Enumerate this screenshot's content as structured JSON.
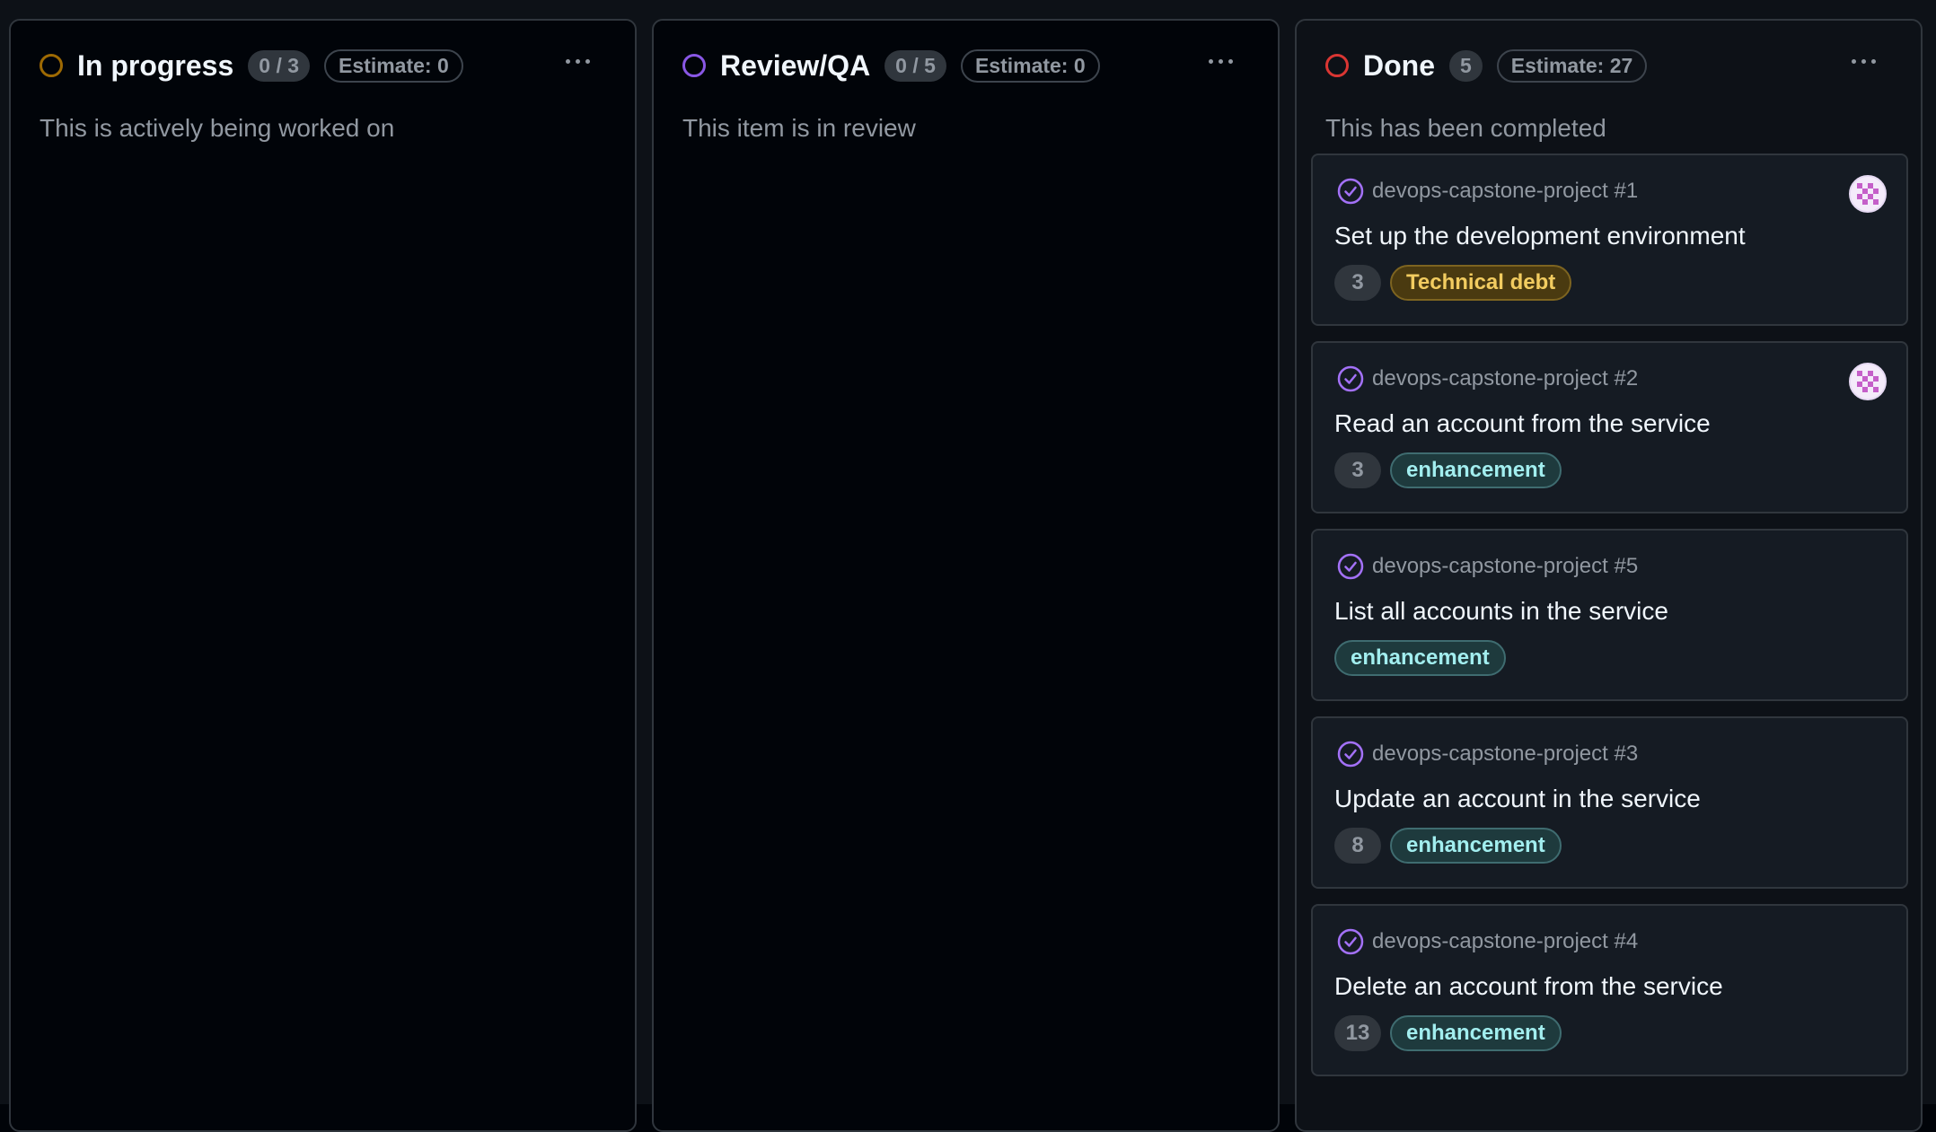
{
  "columns": [
    {
      "title": "In progress",
      "count": "0 / 3",
      "estimate": "Estimate: 0",
      "description": "This is actively being worked on",
      "ring_color": "#9e6a03",
      "cards": []
    },
    {
      "title": "Review/QA",
      "count": "0 / 5",
      "estimate": "Estimate: 0",
      "description": "This item is in review",
      "ring_color": "#8957e5",
      "cards": []
    },
    {
      "title": "Done",
      "count": "5",
      "estimate": "Estimate: 27",
      "description": "This has been completed",
      "ring_color": "#da3633",
      "cards": [
        {
          "ref": "devops-capstone-project #1",
          "title": "Set up the development environment",
          "points": "3",
          "label": "Technical debt",
          "label_color": "#d29922",
          "has_avatar": true
        },
        {
          "ref": "devops-capstone-project #2",
          "title": "Read an account from the service",
          "points": "3",
          "label": "enhancement",
          "label_color": "#a2eeef",
          "has_avatar": true
        },
        {
          "ref": "devops-capstone-project #5",
          "title": "List all accounts in the service",
          "points": "",
          "label": "enhancement",
          "label_color": "#a2eeef",
          "has_avatar": false
        },
        {
          "ref": "devops-capstone-project #3",
          "title": "Update an account in the service",
          "points": "8",
          "label": "enhancement",
          "label_color": "#a2eeef",
          "has_avatar": false
        },
        {
          "ref": "devops-capstone-project #4",
          "title": "Delete an account from the service",
          "points": "13",
          "label": "enhancement",
          "label_color": "#a2eeef",
          "has_avatar": false
        }
      ]
    }
  ],
  "icons": {
    "status": "circle-status-icon",
    "closed_issue": "check-circle-icon",
    "menu": "kebab-menu-icon",
    "avatar": "identicon-avatar"
  },
  "colors": {
    "check_icon": "#a371f7",
    "background": "#010409",
    "card_background": "#151b23"
  }
}
